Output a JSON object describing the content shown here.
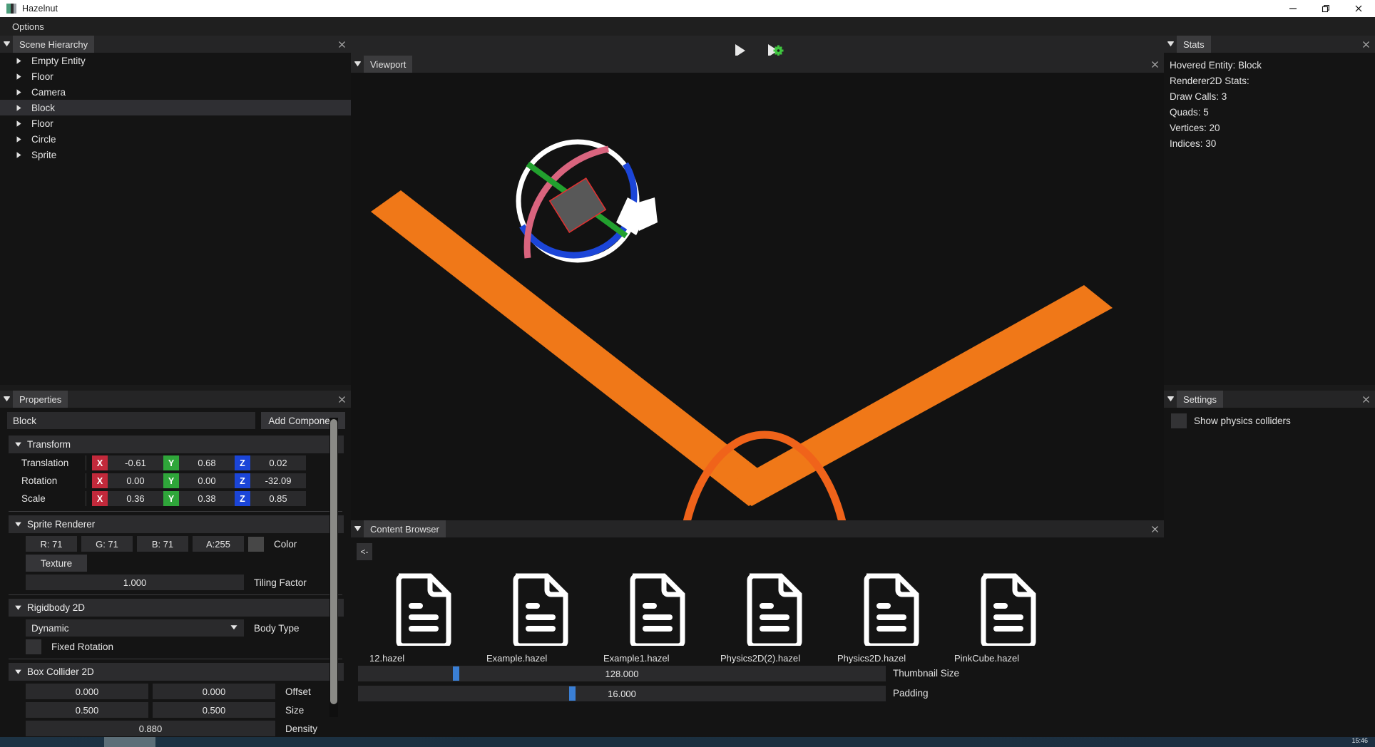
{
  "window": {
    "title": "Hazelnut",
    "icon": "app-icon",
    "minimize": "minimize-icon",
    "maximize": "maximize-icon",
    "close": "close-icon"
  },
  "menubar": {
    "items": [
      {
        "label": "Options"
      }
    ]
  },
  "scene_hierarchy": {
    "title": "Scene Hierarchy",
    "items": [
      {
        "label": "Empty Entity",
        "selected": false
      },
      {
        "label": "Floor",
        "selected": false
      },
      {
        "label": "Camera",
        "selected": false
      },
      {
        "label": "Block",
        "selected": true
      },
      {
        "label": "Floor",
        "selected": false
      },
      {
        "label": "Circle",
        "selected": false
      },
      {
        "label": "Sprite",
        "selected": false
      }
    ]
  },
  "properties": {
    "title": "Properties",
    "entity_name": "Block",
    "add_component_label": "Add Component",
    "transform": {
      "title": "Transform",
      "rows": [
        {
          "label": "Translation",
          "x": "-0.61",
          "y": "0.68",
          "z": "0.02"
        },
        {
          "label": "Rotation",
          "x": "0.00",
          "y": "0.00",
          "z": "-32.09"
        },
        {
          "label": "Scale",
          "x": "0.36",
          "y": "0.38",
          "z": "0.85"
        }
      ],
      "axis_labels": {
        "x": "X",
        "y": "Y",
        "z": "Z"
      },
      "axis_colors": {
        "x": "#c2293b",
        "y": "#2fa63a",
        "z": "#1b45d8"
      }
    },
    "sprite_renderer": {
      "title": "Sprite Renderer",
      "r": "R: 71",
      "g": "G: 71",
      "b": "B: 71",
      "a": "A:255",
      "color_label": "Color",
      "color_value": "#474747",
      "texture_label": "Texture",
      "tiling_factor_value": "1.000",
      "tiling_factor_label": "Tiling Factor"
    },
    "rigidbody2d": {
      "title": "Rigidbody 2D",
      "body_type_value": "Dynamic",
      "body_type_label": "Body Type",
      "fixed_rotation_label": "Fixed Rotation",
      "fixed_rotation_checked": false
    },
    "box_collider2d": {
      "title": "Box Collider 2D",
      "offset_x": "0.000",
      "offset_y": "0.000",
      "offset_label": "Offset",
      "size_x": "0.500",
      "size_y": "0.500",
      "size_label": "Size",
      "density_value": "0.880",
      "density_label": "Density"
    }
  },
  "toolbar": {
    "play_icon": "play-icon",
    "simulate_icon": "simulate-icon"
  },
  "viewport": {
    "title": "Viewport",
    "gizmo": {
      "type": "rotation-gizmo",
      "outer_circle_color": "#ffffff",
      "arc_blue": "#1b45d8",
      "arc_pink": "#d9647e",
      "axis_green": "#22a02e",
      "selected_outline": "#e03030",
      "entity_fill": "#585858"
    },
    "shapes": [
      {
        "name": "floor-bar-left",
        "color": "#f07818"
      },
      {
        "name": "floor-bar-right",
        "color": "#f07818"
      },
      {
        "name": "circle-outline",
        "color": "#f0631a"
      }
    ]
  },
  "content_browser": {
    "title": "Content Browser",
    "back_label": "<-",
    "files": [
      {
        "name": "12.hazel"
      },
      {
        "name": "Example.hazel"
      },
      {
        "name": "Example1.hazel"
      },
      {
        "name": "Physics2D(2).hazel"
      },
      {
        "name": "Physics2D.hazel"
      },
      {
        "name": "PinkCube.hazel"
      }
    ],
    "thumbnail_size": {
      "value": "128.000",
      "label": "Thumbnail Size",
      "knob_pct": 18
    },
    "padding": {
      "value": "16.000",
      "label": "Padding",
      "knob_pct": 40
    }
  },
  "stats": {
    "title": "Stats",
    "lines": [
      "Hovered Entity: Block",
      "Renderer2D Stats:",
      "Draw Calls: 3",
      "Quads: 5",
      "Vertices: 20",
      "Indices: 30"
    ]
  },
  "settings": {
    "title": "Settings",
    "show_physics_colliders_label": "Show physics colliders",
    "show_physics_colliders_checked": false
  },
  "taskbar": {
    "clock": "15:46"
  }
}
